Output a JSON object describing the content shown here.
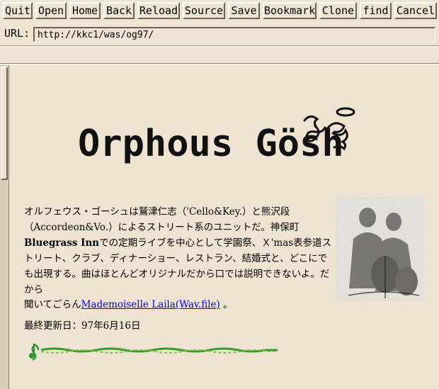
{
  "toolbar": {
    "buttons": [
      {
        "id": "quit",
        "label": "Quit"
      },
      {
        "id": "open",
        "label": "Open"
      },
      {
        "id": "home",
        "label": "Home"
      },
      {
        "id": "back",
        "label": "Back"
      },
      {
        "id": "reload",
        "label": "Reload"
      },
      {
        "id": "source",
        "label": "Source"
      },
      {
        "id": "save",
        "label": "Save"
      },
      {
        "id": "bookmark",
        "label": "Bookmark"
      },
      {
        "id": "clone",
        "label": "Clone"
      },
      {
        "id": "find",
        "label": "find"
      },
      {
        "id": "cancel",
        "label": "Cancel"
      }
    ]
  },
  "url": {
    "label": "URL:",
    "value": "http://kkc1/was/og97/"
  },
  "content": {
    "logo_text": "Orphous Gösh",
    "para1_a": "オルフェウス・ゴーシュは鷲津仁志（'Cello&Key.）と熊沢段（Accordeon&Vo.）によるストリート系のユニットだ。神保町",
    "para1_bold1": "Bluegrass Inn",
    "para1_b": "での定期ライブを中心として学園祭、Ｘ'mas表参道ストリート、クラブ、ディナーショー、レストラン、結婚式と、どこにでも出現する。曲はほとんどオリジナルだから口では説明できないよ。だから",
    "listen_prefix": "聞いてごらん",
    "listen_link": "Mademoiselle Laila(Wav.file)",
    "listen_suffix": "。",
    "updated": "最終更新日：97年6月16日"
  },
  "colors": {
    "background": "#efe3d2",
    "link": "#0000ee",
    "vine": "#3a9a2a"
  }
}
